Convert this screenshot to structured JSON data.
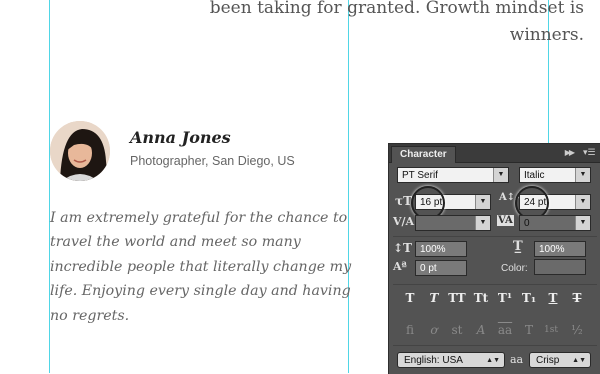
{
  "body_text": {
    "line1": "been taking for granted. Growth mindset is",
    "line2": "winners."
  },
  "profile": {
    "name": "Anna Jones",
    "role": "Photographer, San Diego, US"
  },
  "quote": "I am extremely grateful for the chance to travel the world and meet so many incredible people that literally change my life. Enjoying every single day and having no regrets.",
  "panel": {
    "tab": "Character",
    "font_family": "PT Serif",
    "font_style": "Italic",
    "font_size": "16 pt",
    "leading": "24 pt",
    "kerning": "",
    "tracking": "0",
    "vertical_scale": "100%",
    "horizontal_scale": "100%",
    "baseline_shift": "0 pt",
    "color_label": "Color:",
    "language": "English: USA",
    "aa_label": "aa",
    "antialias": "Crisp",
    "style_buttons": [
      "T",
      "T",
      "TT",
      "Tt",
      "T¹",
      "T₁",
      "T",
      "T"
    ],
    "feature_buttons": [
      "fi",
      "ơ",
      "st",
      "A",
      "aa",
      "T",
      "1st",
      "½"
    ]
  },
  "colors": {
    "guide": "#4fd6e6",
    "panel_bg": "#535353"
  }
}
